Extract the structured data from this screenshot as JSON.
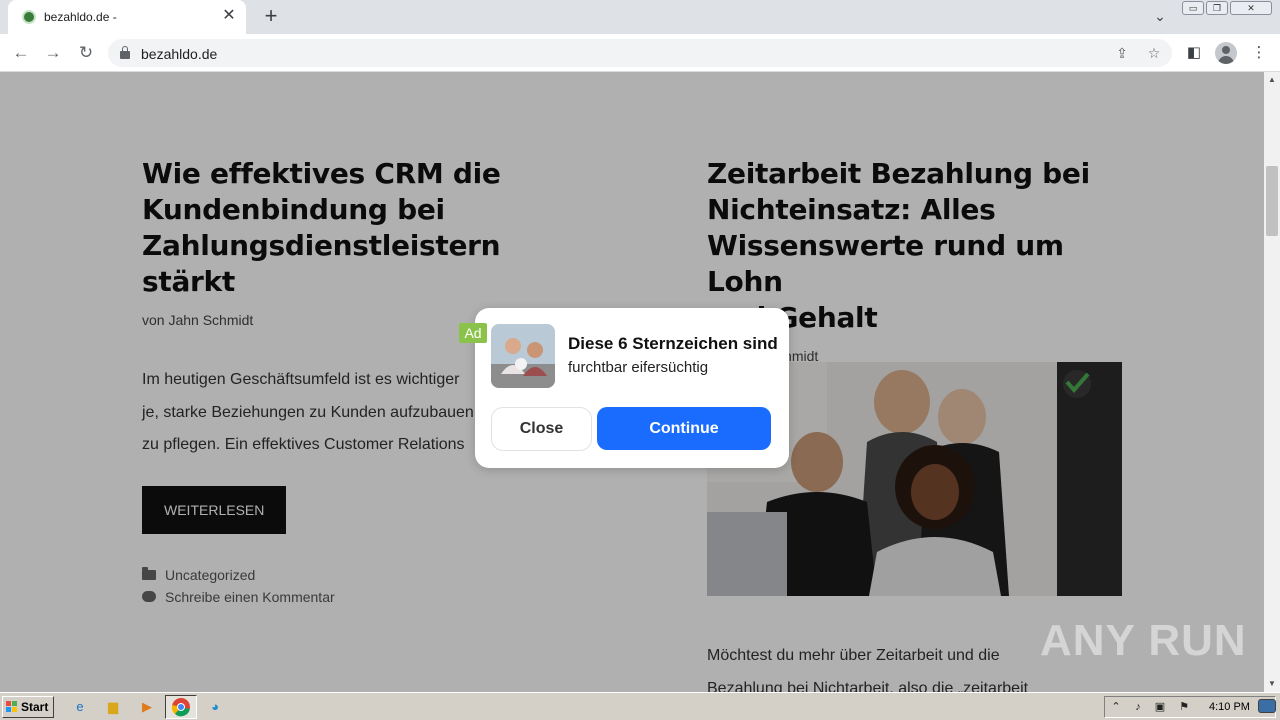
{
  "browser": {
    "tab_title": "bezahldo.de -",
    "tab_close": "✕",
    "new_tab": "+",
    "url": "bezahldo.de"
  },
  "articles": [
    {
      "title": "Wie effektives CRM die Kundenbindung bei Zahlungsdienstleistern stärkt",
      "title_lines": [
        "Wie effektives CRM die",
        "Kundenbindung bei",
        "Zahlungsdienstleistern",
        "stärkt"
      ],
      "byline": "von Jahn Schmidt",
      "excerpt_lines": [
        "Im heutigen Geschäftsumfeld ist es wichtiger",
        "je, starke Beziehungen zu Kunden aufzubauen",
        "zu pflegen. Ein effektives Customer Relations"
      ],
      "read_more": "WEITERLESEN",
      "category": "Uncategorized",
      "comment": "Schreibe einen Kommentar"
    },
    {
      "title": "Zeitarbeit Bezahlung bei Nichteinsatz: Alles Wissenswerte rund um Lohn und Gehalt",
      "title_lines": [
        "Zeitarbeit Bezahlung bei",
        "Nichteinsatz: Alles",
        "Wissenswerte rund um Lohn",
        "und Gehalt"
      ],
      "byline": "von Jahn Schmidt",
      "excerpt_lines": [
        "Möchtest du mehr über Zeitarbeit und die",
        "Bezahlung bei Nichtarbeit, also die „zeitarbeit"
      ]
    }
  ],
  "ad": {
    "badge": "Ad",
    "headline": "Diese 6 Sternzeichen sind",
    "subtext": "furchtbar eifersüchtig",
    "close_label": "Close",
    "continue_label": "Continue",
    "continue_color": "#1a6cff"
  },
  "watermark": "ANY RUN",
  "taskbar": {
    "start_label": "Start",
    "clock": "4:10 PM"
  }
}
